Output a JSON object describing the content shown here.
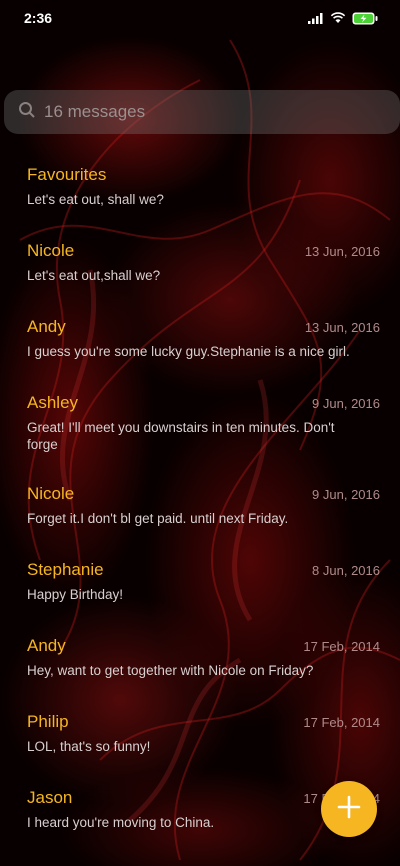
{
  "status_bar": {
    "time": "2:36",
    "icons": [
      "signal-icon",
      "wifi-icon",
      "battery-charging-icon"
    ]
  },
  "search": {
    "placeholder": "16 messages",
    "icon": "search-icon"
  },
  "conversations": [
    {
      "name": "Favourites",
      "date": "",
      "preview": "Let's eat out, shall we?"
    },
    {
      "name": "Nicole",
      "date": "13 Jun, 2016",
      "preview": "Let's eat out,shall we?"
    },
    {
      "name": "Andy",
      "date": "13 Jun, 2016",
      "preview": "I guess you're some lucky guy.Stephanie is a nice girl."
    },
    {
      "name": "Ashley",
      "date": "9 Jun, 2016",
      "preview": "Great! I'll meet you downstairs in ten minutes. Don't forge"
    },
    {
      "name": "Nicole",
      "date": "9 Jun, 2016",
      "preview": "Forget it.I don't bl get paid. until next Friday."
    },
    {
      "name": "Stephanie",
      "date": "8 Jun, 2016",
      "preview": "Happy Birthday!"
    },
    {
      "name": "Andy",
      "date": "17 Feb, 2014",
      "preview": "Hey, want to get together with Nicole on Friday?"
    },
    {
      "name": "Philip",
      "date": "17 Feb, 2014",
      "preview": "LOL, that's so funny!"
    },
    {
      "name": "Jason",
      "date": "17 Feb, 2014",
      "preview": "I heard you're moving to China."
    }
  ],
  "fab": {
    "icon": "plus-icon"
  },
  "colors": {
    "accent": "#f5b622",
    "background": "#080000"
  }
}
